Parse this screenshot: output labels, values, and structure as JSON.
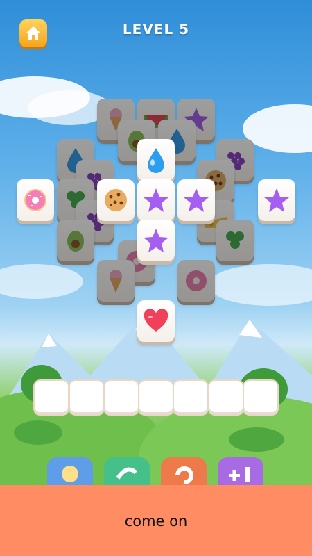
{
  "header": {
    "level_title": "LEVEL 5",
    "home_icon": "home-icon"
  },
  "board": {
    "tiles_top_layer": [
      "water-drop",
      "donut",
      "cookie",
      "star",
      "star",
      "star",
      "star",
      "heart"
    ],
    "tiles_lower_layers": [
      "ice-cream",
      "watermelon",
      "star",
      "avocado",
      "water-drop",
      "water-drop",
      "grapes",
      "grapes",
      "clover",
      "cookie",
      "cheese",
      "grapes",
      "clover",
      "avocado",
      "donut",
      "ice-cream",
      "donut"
    ]
  },
  "tray": {
    "slot_count": 7
  },
  "powerups": [
    "hint-bulb-icon",
    "shuffle-icon",
    "undo-icon",
    "plus-one-icon"
  ],
  "subtitle": "come on",
  "colors": {
    "bottom_bar": "#ff8c62",
    "home_button": "#f6a41c",
    "star": "#a65ef0",
    "heart": "#f0405a"
  }
}
